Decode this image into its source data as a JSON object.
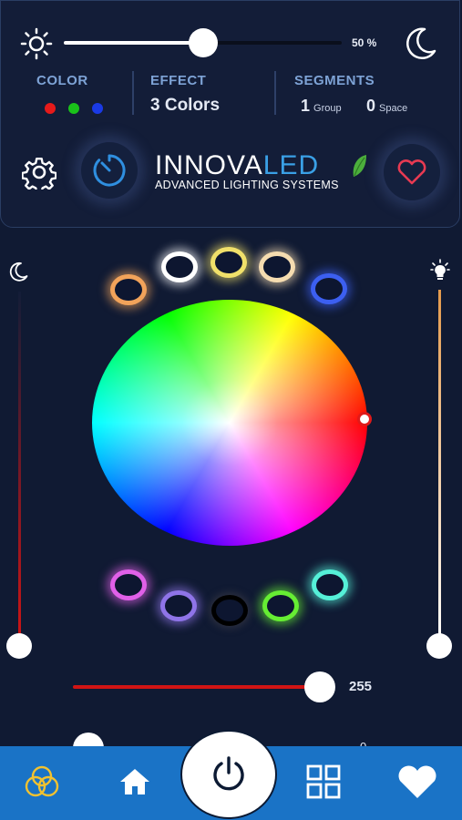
{
  "brightness": {
    "percent_label": "50 %",
    "value": 0.5
  },
  "status": {
    "color_header": "COLOR",
    "effect_header": "EFFECT",
    "effect_value": "3 Colors",
    "segments_header": "SEGMENTS",
    "group_count": "1",
    "group_label": "Group",
    "space_count": "0",
    "space_label": "Space",
    "color_dots": [
      "#e61a1a",
      "#1ac21a",
      "#1a3ae6"
    ]
  },
  "logo": {
    "part1": "INNOVA",
    "part2": "LED",
    "tagline": "ADVANCED LIGHTING SYSTEMS"
  },
  "preset_rings": [
    {
      "name": "preset-orange",
      "color": "#f2a35a"
    },
    {
      "name": "preset-white",
      "color": "#ffffff"
    },
    {
      "name": "preset-yellow",
      "color": "#f0e06a"
    },
    {
      "name": "preset-warm",
      "color": "#f5dcb0"
    },
    {
      "name": "preset-blue",
      "color": "#3c5ff0"
    },
    {
      "name": "preset-magenta",
      "color": "#e060e8"
    },
    {
      "name": "preset-violet",
      "color": "#8f74e8"
    },
    {
      "name": "preset-off",
      "color": "#000000"
    },
    {
      "name": "preset-green",
      "color": "#66ee33"
    },
    {
      "name": "preset-cyan",
      "color": "#55f0d8"
    }
  ],
  "intensity": {
    "value": "255"
  },
  "second_slider": {
    "value": "0"
  },
  "colors": {
    "accent": "#1a73c6",
    "red": "#d11414",
    "background": "#101a33"
  },
  "icons": [
    "sun-icon",
    "moon-icon",
    "gear-icon",
    "timer-icon",
    "heart-icon",
    "bulb-icon",
    "color-mix-icon",
    "home-icon",
    "power-icon",
    "grid-icon"
  ]
}
